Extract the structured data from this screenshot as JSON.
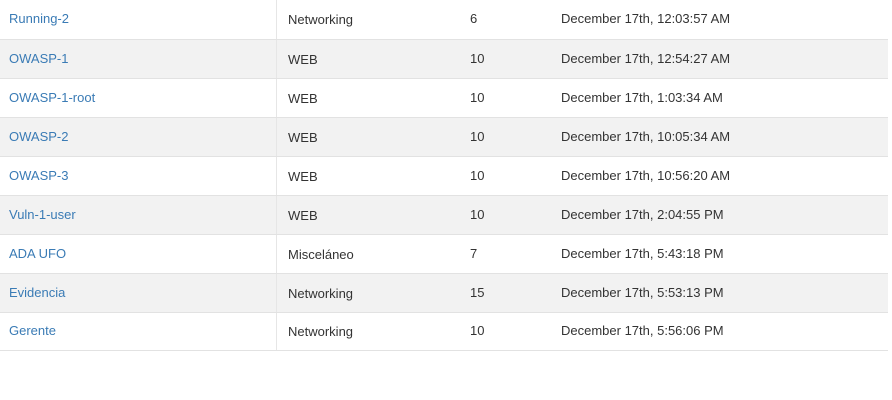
{
  "table": {
    "rows": [
      {
        "name": "Running-2",
        "category": "Networking",
        "score": "6",
        "date": "December 17th, 12:03:57 AM"
      },
      {
        "name": "OWASP-1",
        "category": "WEB",
        "score": "10",
        "date": "December 17th, 12:54:27 AM"
      },
      {
        "name": "OWASP-1-root",
        "category": "WEB",
        "score": "10",
        "date": "December 17th, 1:03:34 AM"
      },
      {
        "name": "OWASP-2",
        "category": "WEB",
        "score": "10",
        "date": "December 17th, 10:05:34 AM"
      },
      {
        "name": "OWASP-3",
        "category": "WEB",
        "score": "10",
        "date": "December 17th, 10:56:20 AM"
      },
      {
        "name": "Vuln-1-user",
        "category": "WEB",
        "score": "10",
        "date": "December 17th, 2:04:55 PM"
      },
      {
        "name": "ADA UFO",
        "category": "Misceláneo",
        "score": "7",
        "date": "December 17th, 5:43:18 PM"
      },
      {
        "name": "Evidencia",
        "category": "Networking",
        "score": "15",
        "date": "December 17th, 5:53:13 PM"
      },
      {
        "name": "Gerente",
        "category": "Networking",
        "score": "10",
        "date": "December 17th, 5:56:06 PM"
      }
    ]
  }
}
